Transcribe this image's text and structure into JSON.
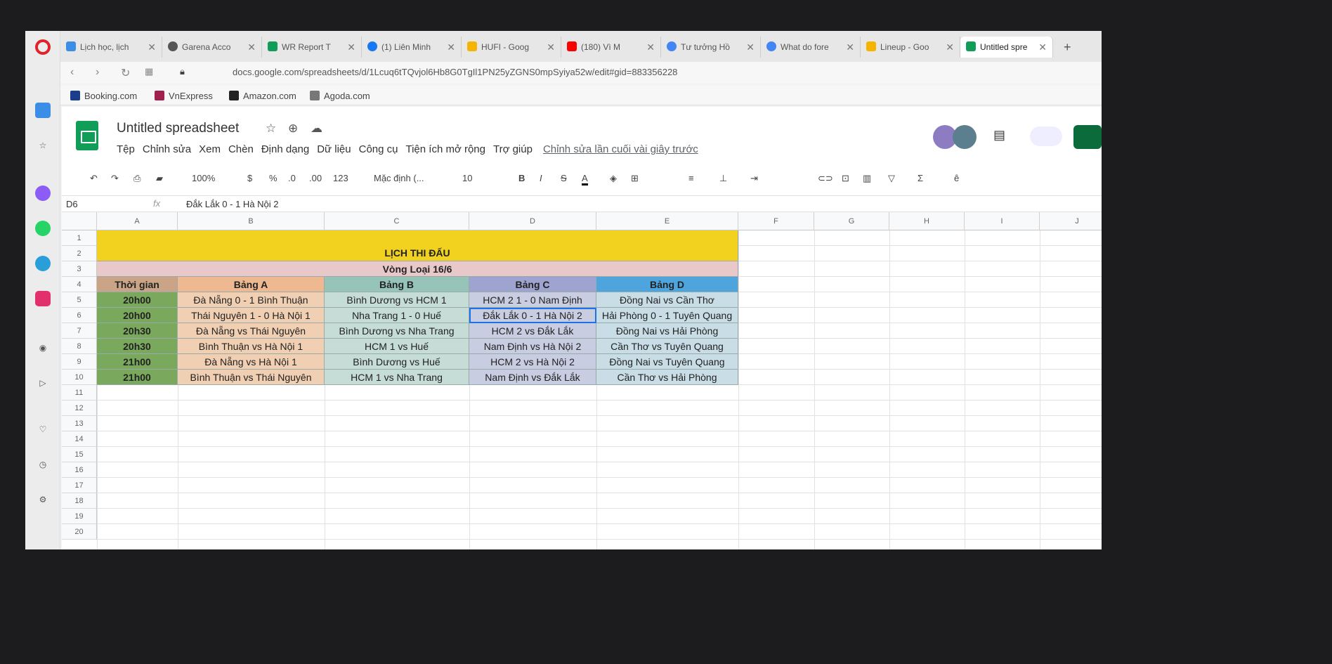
{
  "tabs": [
    {
      "label": "Lịch học, lịch",
      "color": "#3a8ee6"
    },
    {
      "label": "Garena Acco",
      "color": "#555555"
    },
    {
      "label": "WR Report T",
      "color": "#0f9d58"
    },
    {
      "label": "(1) Liên Minh",
      "color": "#1877f2"
    },
    {
      "label": "HUFI - Goog",
      "color": "#f4b400"
    },
    {
      "label": "(180) Vì M",
      "color": "#ff0000"
    },
    {
      "label": "Tư tưởng Hồ",
      "color": "#4285f4"
    },
    {
      "label": "What do fore",
      "color": "#4285f4"
    },
    {
      "label": "Lineup - Goo",
      "color": "#f4b400"
    },
    {
      "label": "Untitled spre",
      "color": "#0f9d58"
    }
  ],
  "address": {
    "url": "docs.google.com/spreadsheets/d/1Lcuq6tTQvjol6Hb8G0TgIl1PN25yZGNS0mpSyiya52w/edit#gid=883356228"
  },
  "bookmarks": [
    {
      "label": "Booking.com",
      "color": "#1a3e8c"
    },
    {
      "label": "VnExpress",
      "color": "#9f224e"
    },
    {
      "label": "Amazon.com",
      "color": "#222222"
    },
    {
      "label": "Agoda.com",
      "color": "#555555"
    }
  ],
  "doc": {
    "title": "Untitled spreadsheet",
    "last_edit": "Chỉnh sửa lần cuối vài giây trước"
  },
  "menus": [
    "Tệp",
    "Chỉnh sửa",
    "Xem",
    "Chèn",
    "Định dạng",
    "Dữ liệu",
    "Công cụ",
    "Tiện ích mở rộng",
    "Trợ giúp"
  ],
  "toolbar": {
    "zoom": "100%",
    "currency": "$",
    "percent": "%",
    "dec_dec": ".0",
    "dec_inc": ".00",
    "format": "123",
    "font": "Mặc định (...",
    "font_size": "10",
    "bold": "B",
    "italic": "I",
    "strike": "S",
    "color": "A"
  },
  "formula_bar": {
    "cell_ref": "D6",
    "fx": "fx",
    "value": "Đắk Lắk 0 - 1 Hà Nội 2"
  },
  "columns": [
    "A",
    "B",
    "C",
    "D",
    "E",
    "F",
    "G",
    "H",
    "I",
    "J"
  ],
  "rows": [
    "1",
    "2",
    "3",
    "4",
    "5",
    "6",
    "7",
    "8",
    "9",
    "10",
    "11",
    "12",
    "13",
    "14",
    "15",
    "16",
    "17",
    "18",
    "19",
    "20"
  ],
  "sheet": {
    "title": "LỊCH THI ĐẤU",
    "subtitle": "Vòng Loại 16/6",
    "headers": [
      "Thời gian",
      "Bảng A",
      "Bảng B",
      "Bảng C",
      "Bảng D"
    ],
    "rows": [
      [
        "20h00",
        "Đà Nẵng 0 - 1 Bình Thuận",
        "Bình Dương vs HCM 1",
        "HCM 2 1 - 0 Nam Định",
        "Đồng Nai vs Cần Thơ"
      ],
      [
        "20h00",
        "Thái Nguyên 1 - 0 Hà Nội 1",
        "Nha Trang 1 - 0 Huế",
        "Đắk Lắk 0 - 1 Hà Nội 2",
        "Hải Phòng 0 - 1 Tuyên Quang"
      ],
      [
        "20h30",
        "Đà Nẵng vs Thái Nguyên",
        "Bình Dương vs Nha Trang",
        "HCM 2 vs Đắk Lắk",
        "Đồng Nai vs Hải Phòng"
      ],
      [
        "20h30",
        "Bình Thuận vs Hà Nội 1",
        "HCM 1 vs Huế",
        "Nam Định vs Hà Nội 2",
        "Cần Thơ vs Tuyên Quang"
      ],
      [
        "21h00",
        "Đà Nẵng vs Hà Nội 1",
        "Bình Dương vs Huế",
        "HCM 2 vs Hà Nội 2",
        "Đồng Nai vs Tuyên Quang"
      ],
      [
        "21h00",
        "Bình Thuận vs Thái Nguyên",
        "HCM 1 vs Nha Trang",
        "Nam Định vs Đắk Lắk",
        "Cần Thơ vs Hải Phòng"
      ]
    ]
  },
  "colors": {
    "title_bg": "#f2d21f",
    "subtitle_bg": "#e8c8c8",
    "time_bg": "#7aa85c",
    "time_hdr_bg": "#c9a486",
    "a_bg": "#f0cfb2",
    "b_bg": "#c6dcd6",
    "c_bg": "#c8cde2",
    "d_bg": "#c9dde6",
    "b_hdr": "#97c4b8",
    "c_hdr": "#9ea3cf",
    "d_hdr": "#4ea5dd",
    "a_hdr": "#eeb890"
  }
}
